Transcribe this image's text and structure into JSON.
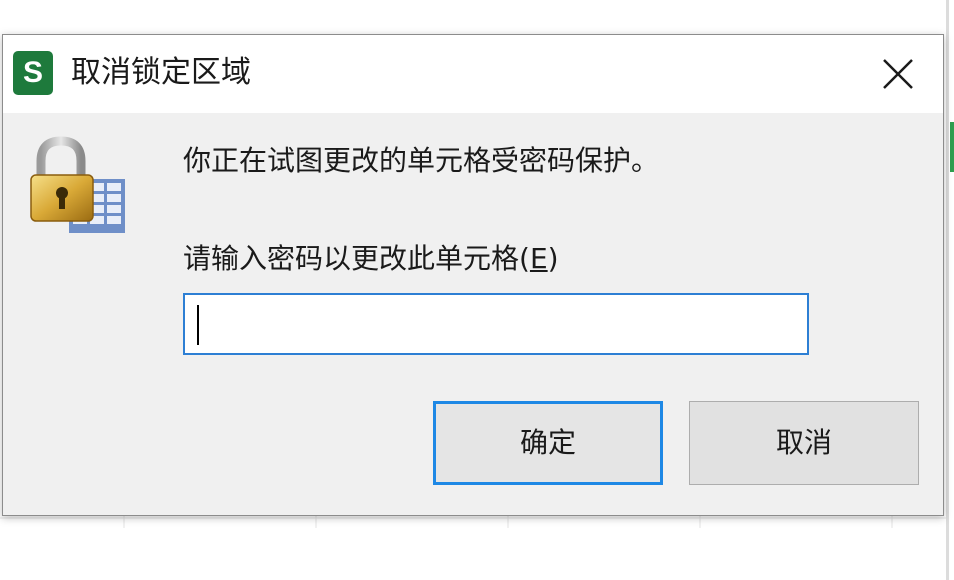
{
  "dialog": {
    "title": "取消锁定区域",
    "app_icon_letter": "S",
    "close_glyph": "✕",
    "message": "你正在试图更改的单元格受密码保护。",
    "prompt_label": "请输入密码以更改此单元格(",
    "prompt_mnemonic": "E",
    "prompt_suffix": ")",
    "password_value": "",
    "ok_label": "确定",
    "cancel_label": "取消"
  },
  "icons": {
    "app": "spreadsheet-app-icon",
    "lock": "padlock-icon",
    "close": "close-icon"
  },
  "colors": {
    "app_icon_bg": "#1e7a3c",
    "focus_border": "#1e88e5",
    "input_border": "#2d7fd4",
    "dialog_bg": "#f0f0f0",
    "titlebar_bg": "#ffffff"
  }
}
